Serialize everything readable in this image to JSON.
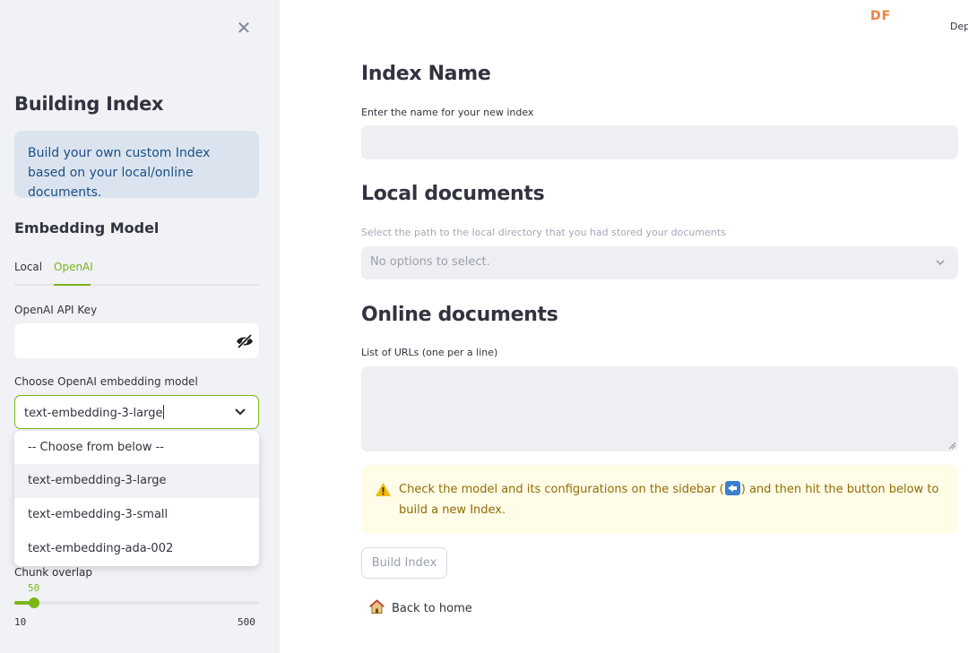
{
  "sidebar": {
    "title": "Building Index",
    "info": "Build your own custom Index based on your local/online documents.",
    "embedding_heading": "Embedding Model",
    "tabs": [
      {
        "label": "Local",
        "active": false
      },
      {
        "label": "OpenAI",
        "active": true
      }
    ],
    "api_key_label": "OpenAI API Key",
    "api_key_value": "",
    "model_label": "Choose OpenAI embedding model",
    "model_selected": "text-embedding-3-large",
    "model_options": [
      "-- Choose from below --",
      "text-embedding-3-large",
      "text-embedding-3-small",
      "text-embedding-ada-002"
    ],
    "chunk_overlap": {
      "label": "Chunk overlap",
      "value": "50",
      "min": "10",
      "max": "500"
    }
  },
  "header": {
    "badge": "DF",
    "deploy_label": "Dep"
  },
  "main": {
    "index_name": {
      "heading": "Index Name",
      "label": "Enter the name for your new index",
      "value": ""
    },
    "local_docs": {
      "heading": "Local documents",
      "label": "Select the path to the local directory that you had stored your documents",
      "placeholder": "No options to select."
    },
    "online_docs": {
      "heading": "Online documents",
      "label": "List of URLs (one per a line)",
      "value": ""
    },
    "warning": {
      "text_before": "Check the model and its configurations on the sidebar (",
      "text_after": ") and then hit the button below to build a new Index."
    },
    "build_button": "Build Index",
    "back_link": "Back to home"
  },
  "colors": {
    "accent": "#7cb518",
    "info_bg": "#dbe4ee",
    "info_text": "#1c4f85",
    "warning_bg": "#fffce7",
    "warning_text": "#926c05",
    "badge": "#f0803c"
  }
}
